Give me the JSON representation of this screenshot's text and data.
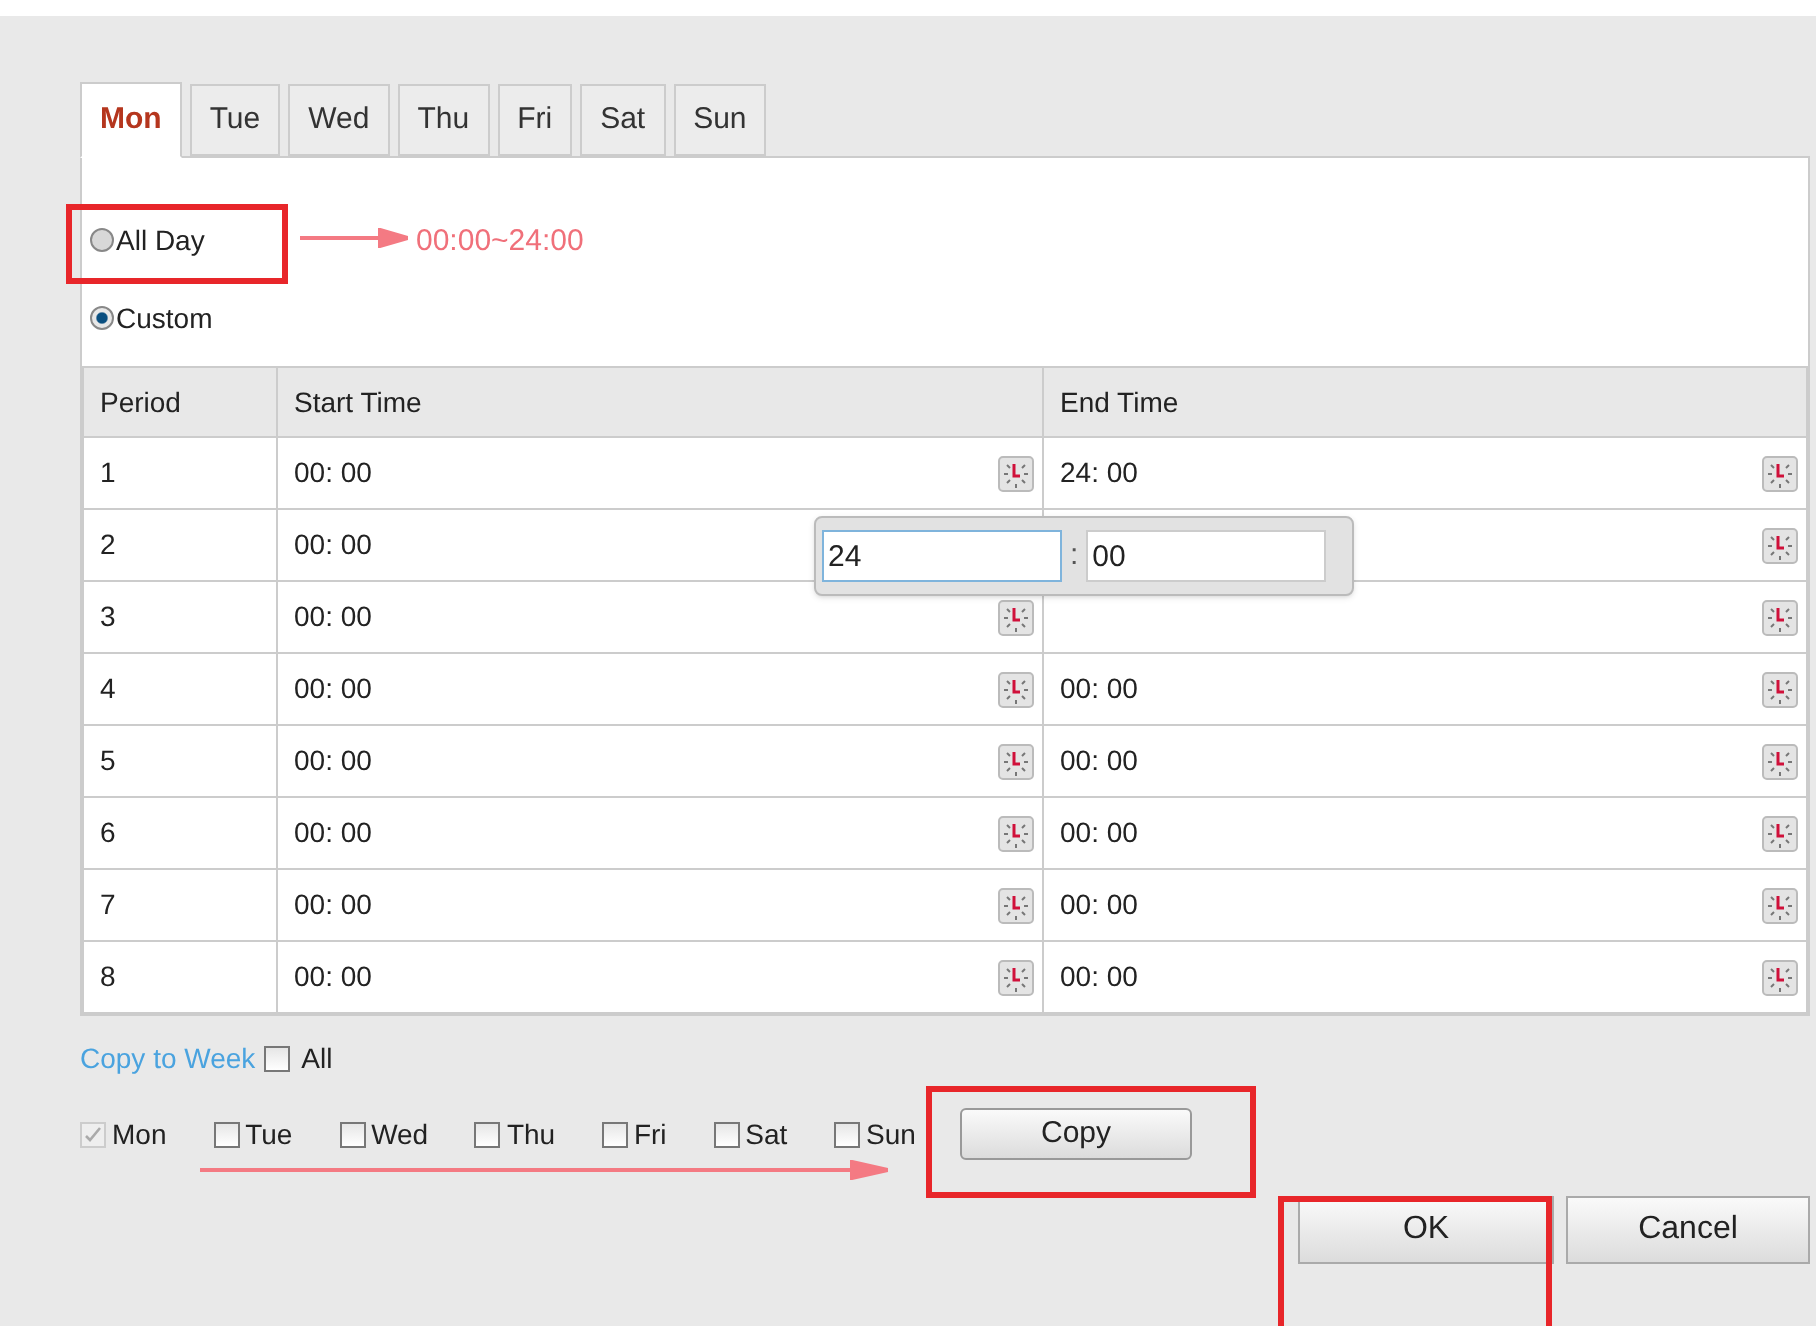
{
  "tabs": [
    {
      "label": "Mon",
      "selected": true
    },
    {
      "label": "Tue",
      "selected": false
    },
    {
      "label": "Wed",
      "selected": false
    },
    {
      "label": "Thu",
      "selected": false
    },
    {
      "label": "Fri",
      "selected": false
    },
    {
      "label": "Sat",
      "selected": false
    },
    {
      "label": "Sun",
      "selected": false
    }
  ],
  "schedule_mode": [
    {
      "label": "All Day",
      "selected": false
    },
    {
      "label": "Custom",
      "selected": true
    }
  ],
  "annotation_text": "00:00~24:00",
  "table": {
    "columns": [
      "Period",
      "Start Time",
      "End Time"
    ],
    "rows": [
      {
        "period": "1",
        "start": "00: 00",
        "end": "24: 00"
      },
      {
        "period": "2",
        "start": "00: 00"
      },
      {
        "period": "3",
        "start": "00: 00"
      },
      {
        "period": "4",
        "start": "00: 00",
        "end": "00: 00"
      },
      {
        "period": "5",
        "start": "00: 00",
        "end": "00: 00"
      },
      {
        "period": "6",
        "start": "00: 00",
        "end": "00: 00"
      },
      {
        "period": "7",
        "start": "00: 00",
        "end": "00: 00"
      },
      {
        "period": "8",
        "start": "00: 00",
        "end": "00: 00"
      }
    ]
  },
  "time_popup": {
    "hour": "24",
    "separator": ":",
    "minute": "00"
  },
  "copy_to_week": {
    "label": "Copy to Week",
    "all": {
      "label": "All",
      "checked": false
    },
    "days": [
      {
        "label": "Mon",
        "checked": true,
        "disabled": true
      },
      {
        "label": "Tue",
        "checked": false,
        "disabled": false
      },
      {
        "label": "Wed",
        "checked": false,
        "disabled": false
      },
      {
        "label": "Thu",
        "checked": false,
        "disabled": false
      },
      {
        "label": "Fri",
        "checked": false,
        "disabled": false
      },
      {
        "label": "Sat",
        "checked": false,
        "disabled": false
      },
      {
        "label": "Sun",
        "checked": false,
        "disabled": false
      }
    ],
    "button": "Copy"
  },
  "footer_buttons": [
    "OK",
    "Cancel"
  ]
}
